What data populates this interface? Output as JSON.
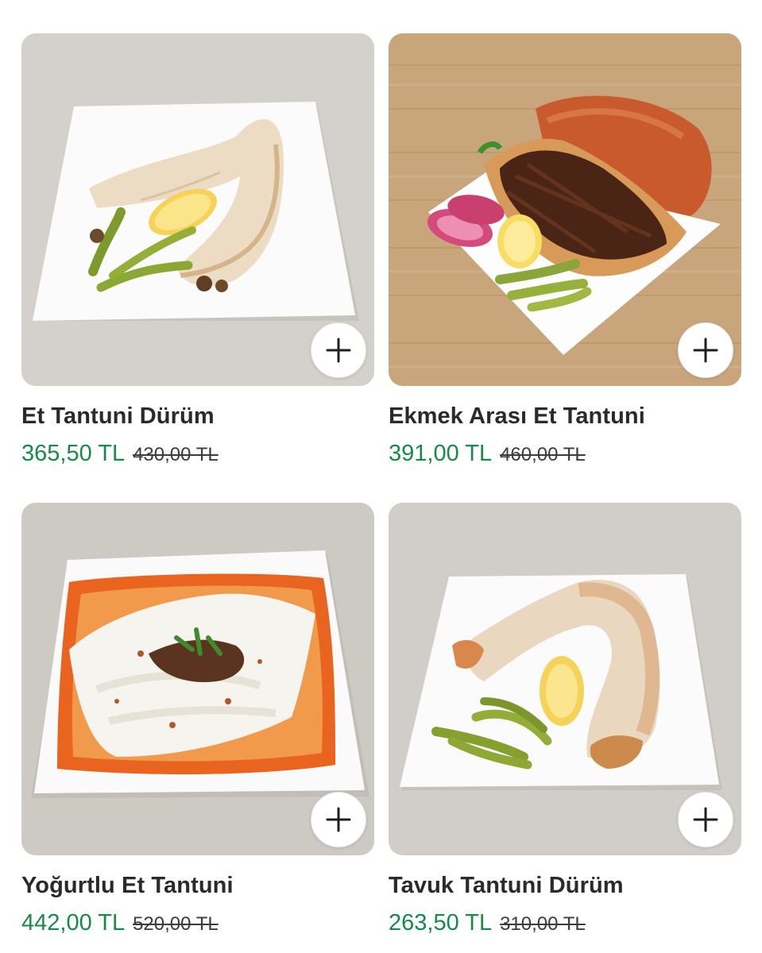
{
  "products": [
    {
      "name": "Et Tantuni Dürüm",
      "price": "365,50 TL",
      "old_price": "430,00 TL",
      "image": "wrap-on-white-plate",
      "add_icon": "plus-icon"
    },
    {
      "name": "Ekmek Arası Et Tantuni",
      "price": "391,00 TL",
      "old_price": "460,00 TL",
      "image": "bread-sandwich-on-plate",
      "add_icon": "plus-icon"
    },
    {
      "name": "Yoğurtlu Et Tantuni",
      "price": "442,00 TL",
      "old_price": "520,00 TL",
      "image": "yogurt-tantuni-on-plate",
      "add_icon": "plus-icon"
    },
    {
      "name": "Tavuk Tantuni Dürüm",
      "price": "263,50 TL",
      "old_price": "310,00 TL",
      "image": "chicken-wrap-on-plate",
      "add_icon": "plus-icon"
    }
  ],
  "colors": {
    "price": "#178a49",
    "name": "#2a2a2a",
    "old_price": "#3c3c3c"
  }
}
